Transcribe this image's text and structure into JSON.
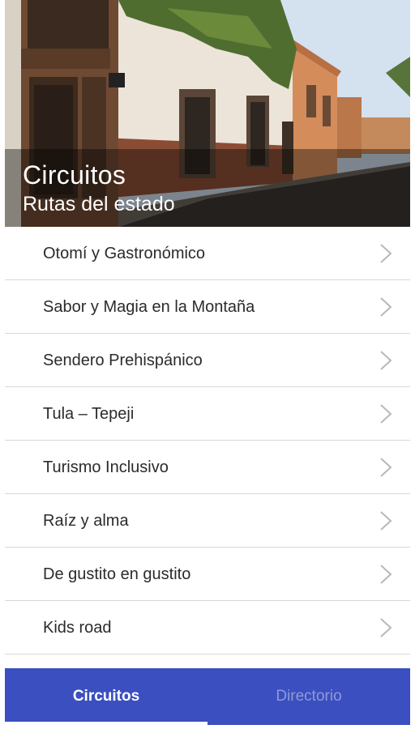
{
  "header": {
    "title": "Circuitos",
    "subtitle": "Rutas del estado"
  },
  "routes": [
    {
      "label": "Otomí y Gastronómico"
    },
    {
      "label": "Sabor y Magia en la Montaña"
    },
    {
      "label": "Sendero Prehispánico"
    },
    {
      "label": "Tula – Tepeji"
    },
    {
      "label": "Turismo Inclusivo"
    },
    {
      "label": "Raíz y alma"
    },
    {
      "label": "De gustito en gustito"
    },
    {
      "label": "Kids road"
    }
  ],
  "tabs": [
    {
      "label": "Circuitos",
      "active": true
    },
    {
      "label": "Directorio",
      "active": false
    }
  ],
  "colors": {
    "tab_bar": "#3b4fc0",
    "tab_inactive_text": "#8e9ad8",
    "divider": "#d8d8d8"
  }
}
